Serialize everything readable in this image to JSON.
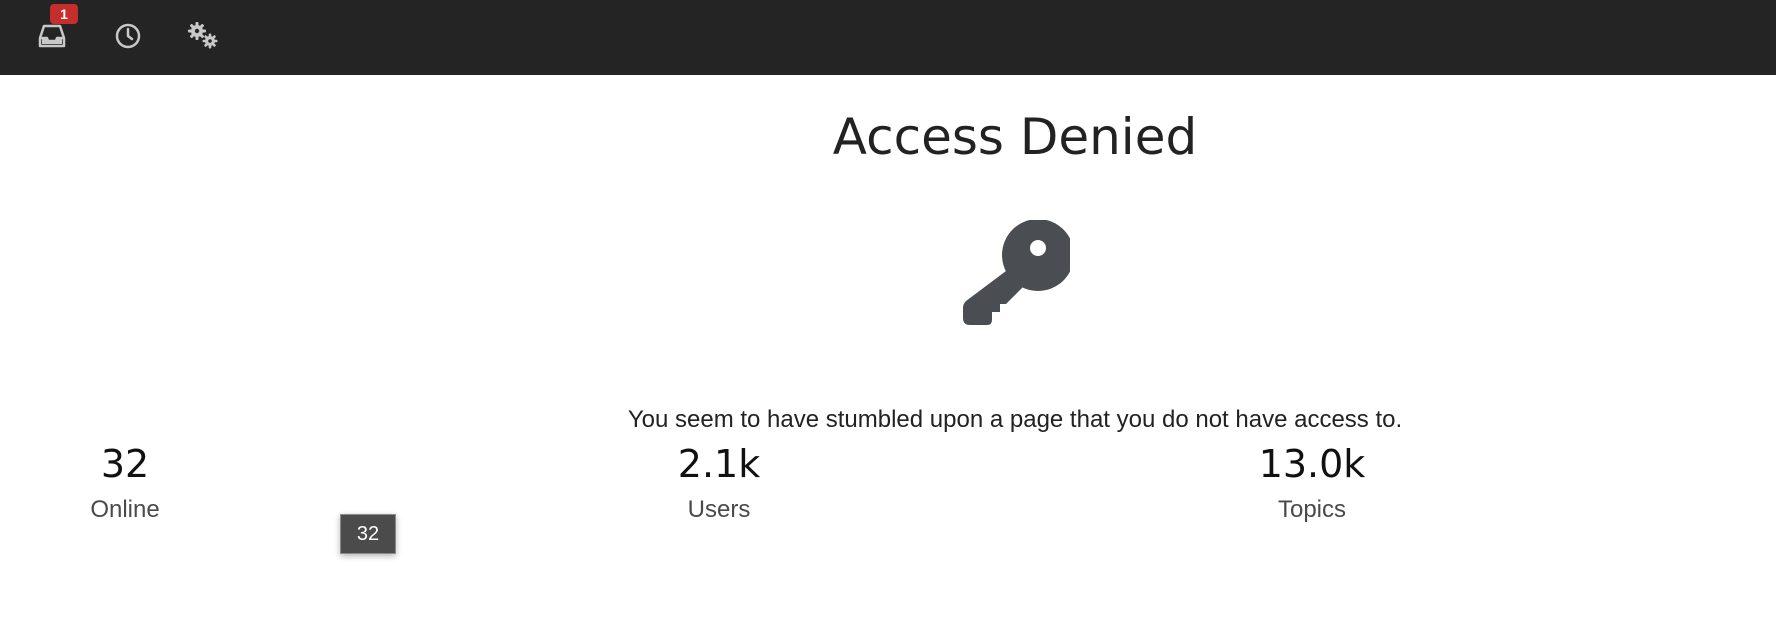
{
  "header": {
    "notifications_badge": "1",
    "icons": [
      "inbox-icon",
      "clock-icon",
      "gears-icon"
    ]
  },
  "main": {
    "title": "Access Denied",
    "icon": "key-icon",
    "message": "You seem to have stumbled upon a page that you do not have access to."
  },
  "stats": [
    {
      "value": "32",
      "label": "Online"
    },
    {
      "value": "2.1k",
      "label": "Users"
    },
    {
      "value": "13.0k",
      "label": "Topics"
    }
  ],
  "tooltip": {
    "text": "32"
  },
  "colors": {
    "topbar": "#242424",
    "badge": "#c62e2e",
    "key": "#4a4d52"
  }
}
